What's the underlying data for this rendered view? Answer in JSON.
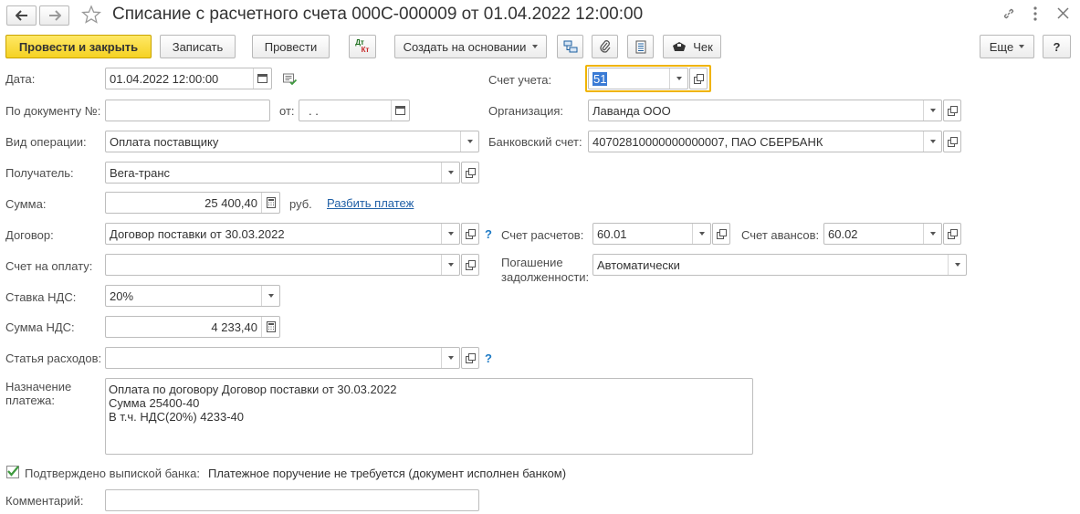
{
  "window": {
    "title": "Списание с расчетного счета 000С-000009 от 01.04.2022 12:00:00"
  },
  "toolbar": {
    "post_close": "Провести и закрыть",
    "save": "Записать",
    "post": "Провести",
    "dtkt_top": "Дт",
    "dtkt_bottom": "Кт",
    "create_based": "Создать на основании",
    "check": "Чек",
    "more": "Еще",
    "help": "?"
  },
  "form": {
    "date_label": "Дата:",
    "date_value": "01.04.2022 12:00:00",
    "docnum_label": "По документу №:",
    "docnum_value": "",
    "from_label": "от:",
    "from_value": " .  .",
    "optype_label": "Вид операции:",
    "optype_value": "Оплата поставщику",
    "recipient_label": "Получатель:",
    "recipient_value": "Вега-транс",
    "sum_label": "Сумма:",
    "sum_value": "25 400,40",
    "currency": "руб.",
    "split_link": "Разбить платеж",
    "contract_label": "Договор:",
    "contract_value": "Договор поставки от 30.03.2022",
    "invoice_label": "Счет на оплату:",
    "invoice_value": "",
    "vat_rate_label": "Ставка НДС:",
    "vat_rate_value": "20%",
    "vat_sum_label": "Сумма НДС:",
    "vat_sum_value": "4 233,40",
    "expense_label": "Статья расходов:",
    "expense_value": "",
    "purpose_label_1": "Назначение",
    "purpose_label_2": "платежа:",
    "purpose_line_1": "Оплата по договору Договор поставки от 30.03.2022",
    "purpose_line_2": "Сумма 25400-40",
    "purpose_line_3": "В т.ч. НДС(20%) 4233-40",
    "confirmed_label": "Подтверждено выпиской банка:",
    "confirmed_checked": true,
    "confirmed_note": "Платежное поручение не требуется (документ исполнен банком)",
    "comment_label": "Комментарий:",
    "comment_value": "",
    "account_label": "Счет учета:",
    "account_value": "51",
    "org_label": "Организация:",
    "org_value": "Лаванда ООО",
    "bank_label": "Банковский счет:",
    "bank_value": "40702810000000000007, ПАО СБЕРБАНК",
    "settle_label": "Счет расчетов:",
    "settle_value": "60.01",
    "advance_label": "Счет авансов:",
    "advance_value": "60.02",
    "repay_label_1": "Погашение",
    "repay_label_2": "задолженности:",
    "repay_value": "Автоматически",
    "question_mark": "?"
  },
  "colors": {
    "primary_button": "#f5d223",
    "focus_border": "#f0b400",
    "link": "#1f5fa6",
    "help_mark": "#1d7ac5",
    "check_green": "#3f9a3f"
  }
}
